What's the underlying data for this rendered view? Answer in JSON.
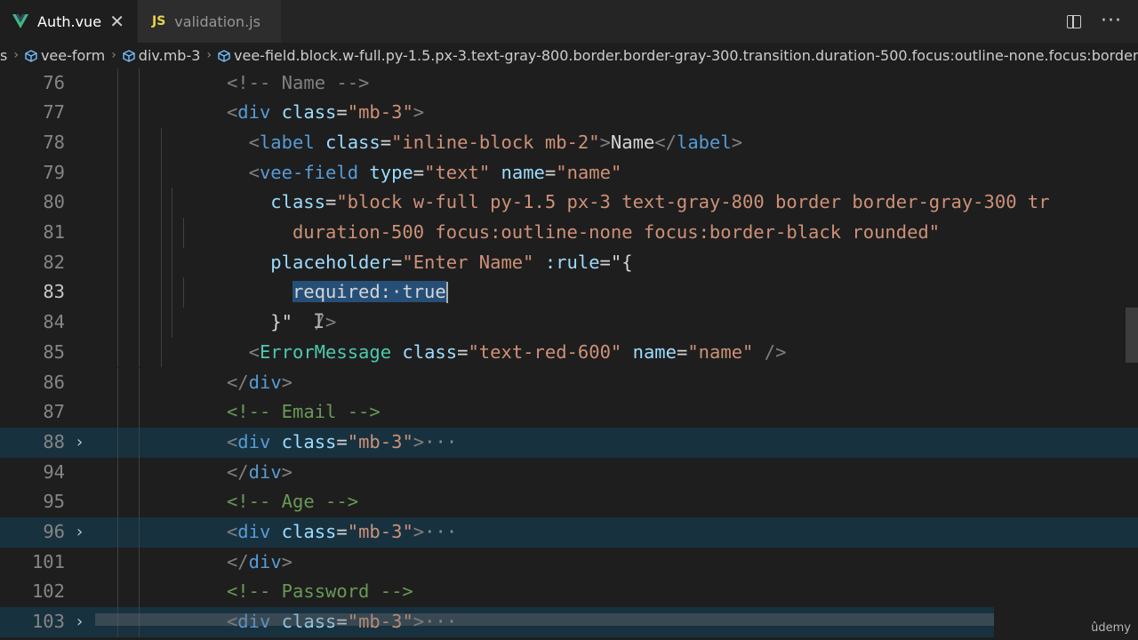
{
  "tabs": {
    "active": {
      "label": "Auth.vue",
      "icon": "vue-icon",
      "close": "✕"
    },
    "inactive": {
      "label": "validation.js",
      "badge": "JS"
    },
    "actions": {
      "more": "···"
    }
  },
  "breadcrumb": {
    "lead": "s",
    "items": [
      "vee-form",
      "div.mb-3",
      "vee-field.block.w-full.py-1.5.px-3.text-gray-800.border.border-gray-300.transition.duration-500.focus:outline-none.focus:border-black...."
    ]
  },
  "editor": {
    "current_line": "83",
    "lines": [
      {
        "num": "76",
        "tokens": [
          [
            "t-tag",
            "<!-- Name -->"
          ]
        ]
      },
      {
        "num": "77",
        "tokens": [
          [
            "t-tag",
            "<"
          ],
          [
            "t-tagname",
            "div"
          ],
          [
            "t-text",
            " "
          ],
          [
            "t-attr",
            "class"
          ],
          [
            "t-text",
            "="
          ],
          [
            "t-str",
            "\"mb-3\""
          ],
          [
            "t-tag",
            ">"
          ]
        ]
      },
      {
        "num": "78",
        "tokens": [
          [
            "t-tag",
            "<"
          ],
          [
            "t-tagname",
            "label"
          ],
          [
            "t-text",
            " "
          ],
          [
            "t-attr",
            "class"
          ],
          [
            "t-text",
            "="
          ],
          [
            "t-str",
            "\"inline-block mb-2\""
          ],
          [
            "t-tag",
            ">"
          ],
          [
            "t-text",
            "Name"
          ],
          [
            "t-tag",
            "</"
          ],
          [
            "t-tagname",
            "label"
          ],
          [
            "t-tag",
            ">"
          ]
        ]
      },
      {
        "num": "79",
        "tokens": [
          [
            "t-tag",
            "<"
          ],
          [
            "t-tagname",
            "vee-field"
          ],
          [
            "t-text",
            " "
          ],
          [
            "t-attr",
            "type"
          ],
          [
            "t-text",
            "="
          ],
          [
            "t-str",
            "\"text\""
          ],
          [
            "t-text",
            " "
          ],
          [
            "t-attr",
            "name"
          ],
          [
            "t-text",
            "="
          ],
          [
            "t-str",
            "\"name\""
          ]
        ]
      },
      {
        "num": "80",
        "tokens": [
          [
            "t-attr",
            "class"
          ],
          [
            "t-text",
            "="
          ],
          [
            "t-str",
            "\"block w-full py-1.5 px-3 text-gray-800 border border-gray-300 tr"
          ]
        ]
      },
      {
        "num": "81",
        "tokens": [
          [
            "t-str",
            "duration-500 focus:outline-none focus:border-black rounded\""
          ]
        ]
      },
      {
        "num": "82",
        "tokens": [
          [
            "t-attr",
            "placeholder"
          ],
          [
            "t-text",
            "="
          ],
          [
            "t-str",
            "\"Enter Name\""
          ],
          [
            "t-text",
            " "
          ],
          [
            "t-attr",
            ":rule"
          ],
          [
            "t-text",
            "=\"{"
          ]
        ]
      },
      {
        "num": "83",
        "tokens": [
          [
            "t-text sel",
            "required:·true"
          ]
        ]
      },
      {
        "num": "84",
        "tokens": [
          [
            "t-text",
            "}\""
          ],
          [
            "t-text",
            "  "
          ],
          [
            "t-tag",
            "/>"
          ]
        ]
      },
      {
        "num": "85",
        "tokens": [
          [
            "t-tag",
            "<"
          ],
          [
            "t-comp",
            "ErrorMessage"
          ],
          [
            "t-text",
            " "
          ],
          [
            "t-attr",
            "class"
          ],
          [
            "t-text",
            "="
          ],
          [
            "t-str",
            "\"text-red-600\""
          ],
          [
            "t-text",
            " "
          ],
          [
            "t-attr",
            "name"
          ],
          [
            "t-text",
            "="
          ],
          [
            "t-str",
            "\"name\""
          ],
          [
            "t-text",
            " "
          ],
          [
            "t-tag",
            "/>"
          ]
        ]
      },
      {
        "num": "86",
        "tokens": [
          [
            "t-tag",
            "</"
          ],
          [
            "t-tagname",
            "div"
          ],
          [
            "t-tag",
            ">"
          ]
        ]
      },
      {
        "num": "87",
        "tokens": [
          [
            "t-cmt",
            "<!-- Email -->"
          ]
        ]
      },
      {
        "num": "88",
        "tokens": [
          [
            "t-tag",
            "<"
          ],
          [
            "t-tagname",
            "div"
          ],
          [
            "t-text",
            " "
          ],
          [
            "t-attr",
            "class"
          ],
          [
            "t-text",
            "="
          ],
          [
            "t-str",
            "\"mb-3\""
          ],
          [
            "t-tag",
            ">"
          ],
          [
            "t-fold",
            "···"
          ]
        ]
      },
      {
        "num": "94",
        "tokens": [
          [
            "t-tag",
            "</"
          ],
          [
            "t-tagname",
            "div"
          ],
          [
            "t-tag",
            ">"
          ]
        ]
      },
      {
        "num": "95",
        "tokens": [
          [
            "t-cmt",
            "<!-- Age -->"
          ]
        ]
      },
      {
        "num": "96",
        "tokens": [
          [
            "t-tag",
            "<"
          ],
          [
            "t-tagname",
            "div"
          ],
          [
            "t-text",
            " "
          ],
          [
            "t-attr",
            "class"
          ],
          [
            "t-text",
            "="
          ],
          [
            "t-str",
            "\"mb-3\""
          ],
          [
            "t-tag",
            ">"
          ],
          [
            "t-fold",
            "···"
          ]
        ]
      },
      {
        "num": "101",
        "tokens": [
          [
            "t-tag",
            "</"
          ],
          [
            "t-tagname",
            "div"
          ],
          [
            "t-tag",
            ">"
          ]
        ]
      },
      {
        "num": "102",
        "tokens": [
          [
            "t-cmt",
            "<!-- Password -->"
          ]
        ]
      },
      {
        "num": "103",
        "tokens": [
          [
            "t-tag",
            "<"
          ],
          [
            "t-tagname",
            "div"
          ],
          [
            "t-text",
            " "
          ],
          [
            "t-attr",
            "class"
          ],
          [
            "t-text",
            "="
          ],
          [
            "t-str",
            "\"mb-3\""
          ],
          [
            "t-tag",
            ">"
          ],
          [
            "t-fold",
            "···"
          ]
        ]
      }
    ]
  },
  "watermark": "ûdemy",
  "colors": {
    "background": "#1e1e1e",
    "tab_bar": "#252526",
    "selection": "#264f78",
    "fold_highlight": "#18313f",
    "vue_green": "#41b883",
    "js_yellow": "#e8d44d",
    "cube_blue": "#75beff"
  }
}
